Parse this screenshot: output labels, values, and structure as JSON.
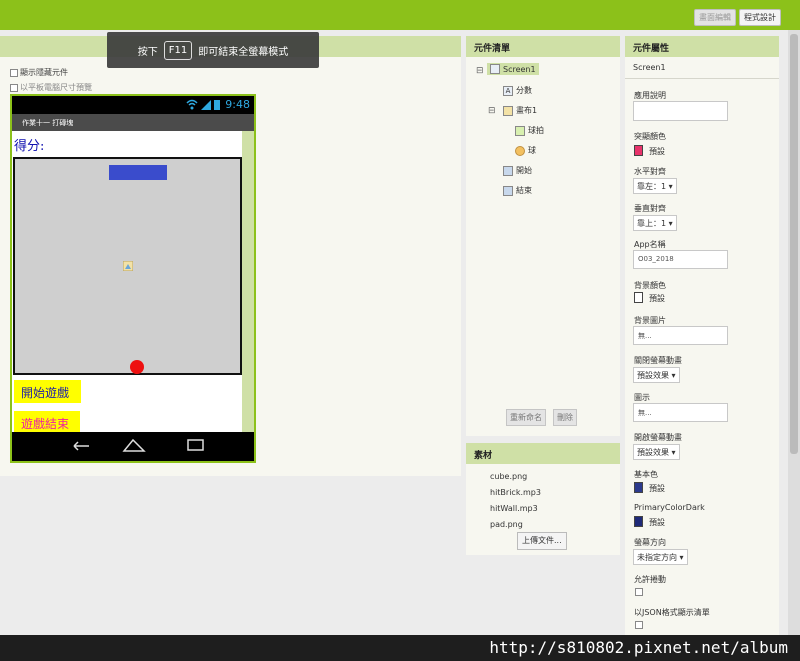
{
  "topbar": {
    "blocks_button": "畫面編輯",
    "designer_button": "程式設計"
  },
  "fullscreen_tip": {
    "prefix": "按下",
    "key": "F11",
    "suffix": "即可結束全螢幕模式"
  },
  "viewer": {
    "show_hidden_label": "顯示隱藏元件",
    "tablet_preview_label": "以平板電腦尺寸預覽"
  },
  "phone": {
    "time": "9:48",
    "app_title": "作業十一 打磚塊",
    "score_label": "得分:",
    "start_button": "開始遊戲",
    "end_button": "遊戲結束"
  },
  "components": {
    "header": "元件清單",
    "tree": [
      "Screen1",
      "分數",
      "畫布1",
      "球拍",
      "球",
      "開始",
      "結束"
    ],
    "rename_button": "重新命名",
    "delete_button": "刪除"
  },
  "media": {
    "header": "素材",
    "files": [
      "cube.png",
      "hitBrick.mp3",
      "hitWall.mp3",
      "pad.png"
    ],
    "upload_button": "上傳文件..."
  },
  "properties": {
    "header": "元件屬性",
    "component": "Screen1",
    "about_label": "應用說明",
    "accent_label": "突顯顏色",
    "accent_value": "預設",
    "accent_color": "#e8336b",
    "align_h_label": "水平對齊",
    "align_h_value": "靠左：1 ▾",
    "align_v_label": "垂直對齊",
    "align_v_value": "靠上：1 ▾",
    "appname_label": "App名稱",
    "appname_value": "O03_2018",
    "bgcolor_label": "背景顏色",
    "bgcolor_value": "預設",
    "bgimage_label": "背景圖片",
    "bgimage_value": "無...",
    "close_anim_label": "關閉螢幕動畫",
    "close_anim_value": "預設效果 ▾",
    "icon_label": "圖示",
    "icon_value": "無...",
    "open_anim_label": "開啟螢幕動畫",
    "open_anim_value": "預設效果 ▾",
    "primary_label": "基本色",
    "primary_value": "預設",
    "primary_color": "#2c3a8c",
    "primary_dark_label": "PrimaryColorDark",
    "primary_dark_value": "預設",
    "primary_dark_color": "#1f2a78",
    "orientation_label": "螢幕方向",
    "orientation_value": "未指定方向 ▾",
    "scrollable_label": "允許捲動",
    "json_label": "以JSON格式顯示清單"
  },
  "watermark": "http://s810802.pixnet.net/album"
}
